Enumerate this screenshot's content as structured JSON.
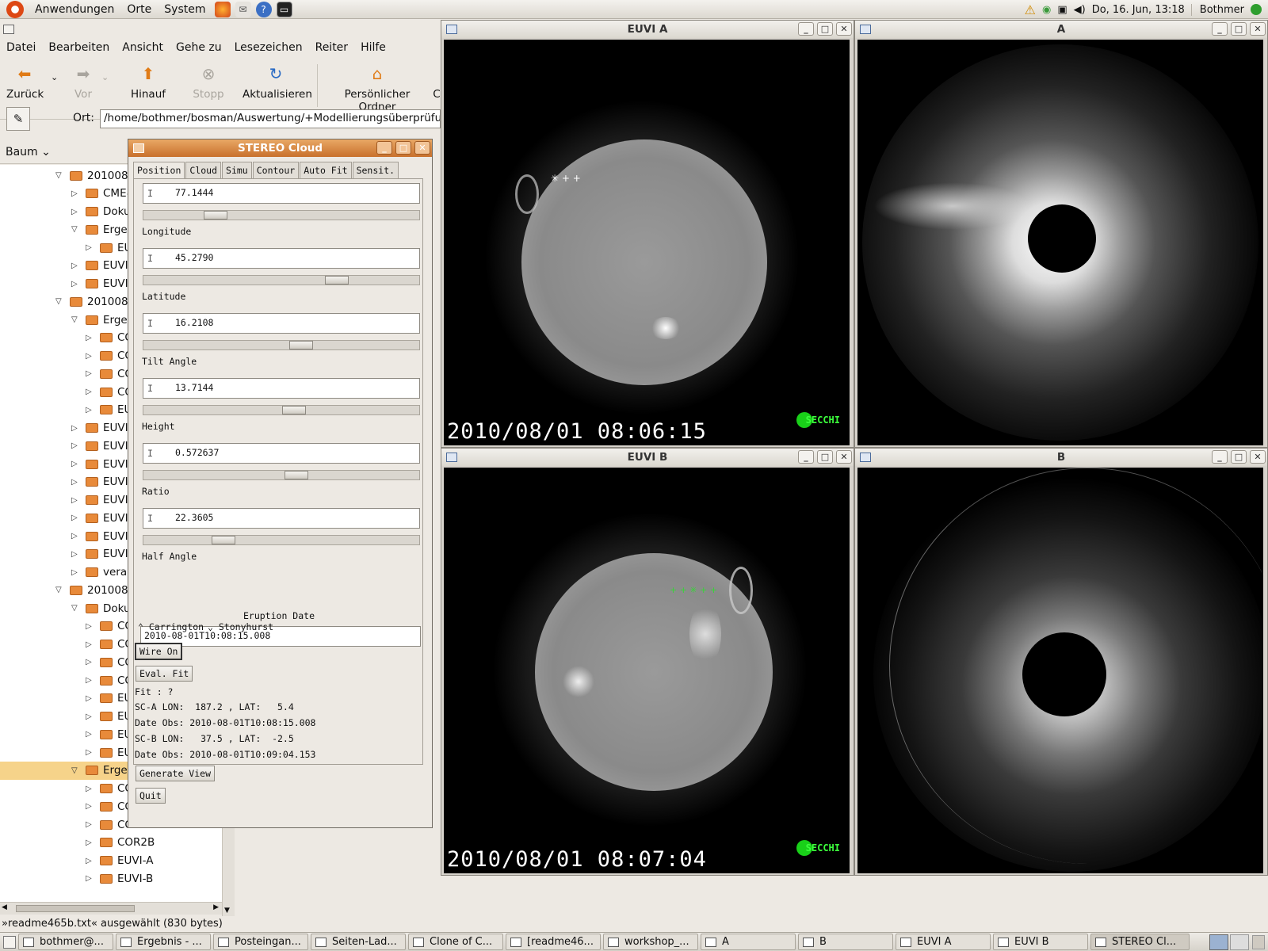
{
  "top_panel": {
    "menus": [
      "Anwendungen",
      "Orte",
      "System"
    ],
    "datetime": "Do, 16. Jun, 13:18",
    "user": "Bothmer"
  },
  "nautilus": {
    "menu": [
      "Datei",
      "Bearbeiten",
      "Ansicht",
      "Gehe zu",
      "Lesezeichen",
      "Reiter",
      "Hilfe"
    ],
    "toolbar": {
      "back": "Zurück",
      "forward": "Vor",
      "up": "Hinauf",
      "stop": "Stopp",
      "reload": "Aktualisieren",
      "home": "Persönlicher Ordner",
      "cut": "C"
    },
    "location_label": "Ort:",
    "location_value": "/home/bothmer/bosman/Auswertung/+Modellierungsüberprüfung+",
    "side_view": "Baum",
    "tree": [
      "2010080",
      "CME#",
      "Doku",
      "Ergeb",
      "EUV",
      "EUVI-",
      "EUVI-",
      "2010080",
      "Ergeb",
      "CO",
      "CO",
      "CO",
      "CO",
      "EU",
      "EUVI-",
      "EUVI-",
      "EUVI-",
      "EUVI-",
      "EUVI-",
      "EUVI-",
      "EUVI-",
      "EUVI-",
      "veralt",
      "2010080",
      "Doku",
      "CO",
      "CO",
      "CO",
      "CO",
      "EU",
      "EU",
      "EU",
      "EU",
      "Ergeb",
      "CO",
      "CO",
      "COR2A",
      "COR2B",
      "EUVI-A",
      "EUVI-B"
    ],
    "status": "»readme465b.txt« ausgewählt (830 bytes)"
  },
  "windows": {
    "euvi_a": {
      "title": "EUVI A",
      "timestamp": "2010/08/01 08:06:15",
      "logo": "SECCHI"
    },
    "cor_a": {
      "title": "A"
    },
    "euvi_b": {
      "title": "EUVI B",
      "timestamp": "2010/08/01 08:07:04",
      "logo": "SECCHI"
    },
    "cor_b": {
      "title": "B"
    }
  },
  "stereo_cloud": {
    "title": "STEREO Cloud",
    "tabs": [
      "Position",
      "Cloud",
      "Simu",
      "Contour",
      "Auto Fit",
      "Sensit."
    ],
    "params": [
      {
        "label": "Longitude",
        "value": "77.1444",
        "slider_level": 0.24
      },
      {
        "label": "Latitude",
        "value": "45.2790",
        "slider_level": 0.72
      },
      {
        "label": "Tilt Angle",
        "value": "16.2108",
        "slider_level": 0.58
      },
      {
        "label": "Height",
        "value": "13.7144",
        "slider_level": 0.55
      },
      {
        "label": "Ratio",
        "value": "0.572637",
        "slider_level": 0.56
      },
      {
        "label": "Half Angle",
        "value": "22.3605",
        "slider_level": 0.27
      }
    ],
    "eruption_date_label": "Eruption Date",
    "eruption_date": "2010-08-01T10:08:15.008",
    "coord_carrington": "Carrington",
    "coord_stonyhurst": "Stonyhurst",
    "wire_button": "Wire On",
    "eval_button": "Eval. Fit",
    "fit": "Fit : ?",
    "sc_a": "SC-A LON:  187.2 , LAT:   5.4",
    "date_obs_a": "Date Obs: 2010-08-01T10:08:15.008",
    "sc_b": "SC-B LON:   37.5 , LAT:  -2.5",
    "date_obs_b": "Date Obs: 2010-08-01T10:09:04.153",
    "generate_button": "Generate View",
    "quit_button": "Quit"
  },
  "taskbar": [
    "bothmer@...",
    "Ergebnis - ...",
    "Posteingan...",
    "Seiten-Lad...",
    "Clone of C...",
    "[readme46...",
    "workshop_...",
    "A",
    "B",
    "EUVI A",
    "EUVI B",
    "STEREO Cl..."
  ],
  "colors": {
    "cloud_titlebar": "#d07a35",
    "selection": "#f6d38a",
    "folder": "#e88a3a",
    "secchi_green": "#19d019"
  }
}
